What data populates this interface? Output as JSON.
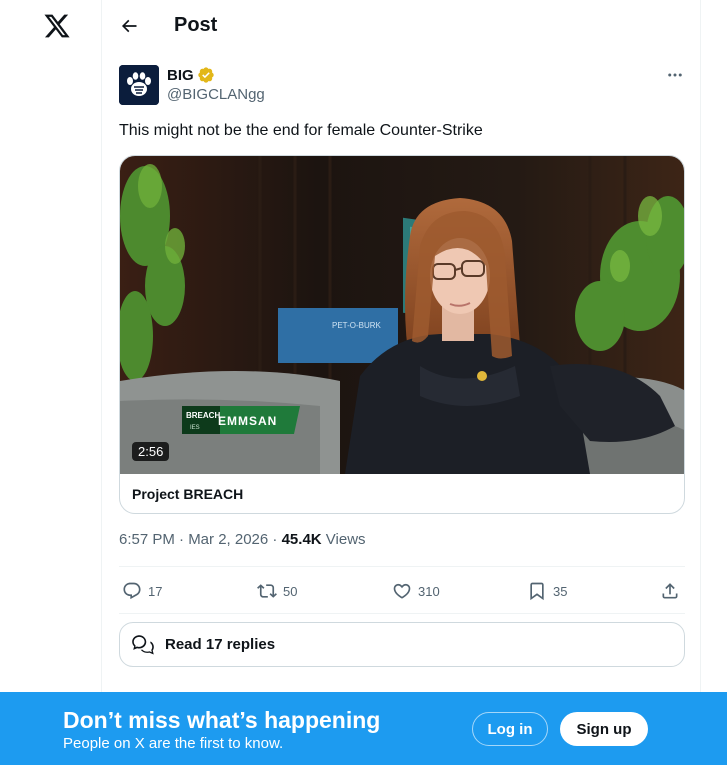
{
  "header": {
    "title": "Post"
  },
  "author": {
    "display_name": "BIG",
    "handle": "@BIGCLANgg"
  },
  "tweet": {
    "text": "This might not be the end for female Counter-Strike",
    "media": {
      "duration": "2:56",
      "card_title": "Project BREACH",
      "overlay_tag": "BREACH",
      "overlay_sub": "IES",
      "overlay_name": "EMMSAN",
      "banner_text": "PET-O-BURK"
    },
    "timestamp": "6:57 PM · Mar 2, 2026",
    "separator": " · ",
    "views_count": "45.4K",
    "views_label": "Views"
  },
  "actions": {
    "replies": "17",
    "reposts": "50",
    "likes": "310",
    "bookmarks": "35"
  },
  "replies_button": {
    "label": "Read 17 replies"
  },
  "banner": {
    "title": "Don’t miss what’s happening",
    "subtitle": "People on X are the first to know.",
    "login_label": "Log in",
    "signup_label": "Sign up"
  },
  "icons": {
    "logo": "x-logo-icon",
    "back": "arrow-left-icon",
    "verified": "verified-badge-icon",
    "more": "more-dots-icon",
    "reply": "reply-icon",
    "repost": "repost-icon",
    "like": "heart-icon",
    "bookmark": "bookmark-icon",
    "share": "share-icon"
  },
  "colors": {
    "accent": "#1d9bf0",
    "verified_gold": "#e2b719",
    "text_primary": "#0f1419",
    "text_secondary": "#536471"
  }
}
